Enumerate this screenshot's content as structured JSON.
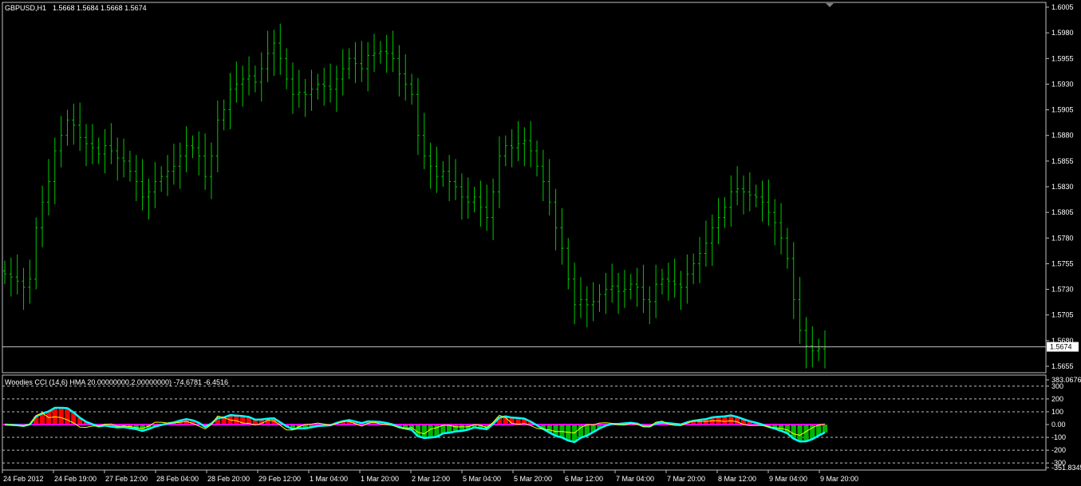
{
  "main_panel": {
    "symbol": "GBPUSD,H1",
    "ohlc": "1.5668 1.5684 1.5668 1.5674",
    "current_price": "1.5674",
    "price_scale": [
      "1.6005",
      "1.5980",
      "1.5955",
      "1.5930",
      "1.5905",
      "1.5880",
      "1.5855",
      "1.5830",
      "1.5805",
      "1.5780",
      "1.5755",
      "1.5730",
      "1.5705",
      "1.5680",
      "1.5655"
    ]
  },
  "indicator_panel": {
    "title": "Woodies CCI (14,6) HMA 20.00000000,2.00000000) -74.6781 -6.4516",
    "scale_labels": [
      "383.0676",
      "300",
      "200",
      "100",
      "0.00",
      "-100",
      "-200",
      "-300",
      "-351.8345"
    ]
  },
  "time_axis": [
    "24 Feb 2012",
    "24 Feb 19:00",
    "27 Feb 12:00",
    "28 Feb 04:00",
    "28 Feb 20:00",
    "29 Feb 12:00",
    "1 Mar 04:00",
    "1 Mar 20:00",
    "2 Mar 12:00",
    "5 Mar 04:00",
    "5 Mar 20:00",
    "6 Mar 12:00",
    "7 Mar 04:00",
    "7 Mar 20:00",
    "8 Mar 12:00",
    "9 Mar 04:00",
    "9 Mar 20:00"
  ],
  "colors": {
    "background": "#000000",
    "grid": "#c0c0c0",
    "bars": "#00c800",
    "text": "#ffffff",
    "cci_positive": "#ff0000",
    "cci_negative": "#00b400",
    "cci_line": "#00ffff",
    "turbo_line": "#ffff00",
    "zero_line": "#ff00ff",
    "zero_fill": "#ff8c00"
  },
  "chart_data": {
    "type": "ohlc",
    "timeframe": "H1",
    "ylim": [
      1.565,
      1.6005
    ],
    "close": [
      1.5745,
      1.5742,
      1.5738,
      1.5732,
      1.574,
      1.579,
      1.5815,
      1.5835,
      1.5865,
      1.588,
      1.5895,
      1.589,
      1.5878,
      1.5872,
      1.5868,
      1.5862,
      1.587,
      1.5865,
      1.5858,
      1.5855,
      1.5845,
      1.5835,
      1.582,
      1.5825,
      1.5835,
      1.584,
      1.5845,
      1.585,
      1.586,
      1.587,
      1.5868,
      1.586,
      1.584,
      1.586,
      1.5895,
      1.5905,
      1.5925,
      1.593,
      1.5935,
      1.5938,
      1.5932,
      1.5945,
      1.596,
      1.597,
      1.5955,
      1.5935,
      1.592,
      1.5922,
      1.592,
      1.5925,
      1.593,
      1.5928,
      1.5925,
      1.5935,
      1.5945,
      1.5955,
      1.595,
      1.5945,
      1.5958,
      1.596,
      1.5962,
      1.596,
      1.5955,
      1.594,
      1.593,
      1.592,
      1.588,
      1.586,
      1.585,
      1.584,
      1.5845,
      1.5835,
      1.583,
      1.582,
      1.5815,
      1.582,
      1.581,
      1.58,
      1.5825,
      1.586,
      1.587,
      1.5868,
      1.5872,
      1.5875,
      1.5865,
      1.585,
      1.5835,
      1.5815,
      1.579,
      1.577,
      1.574,
      1.5715,
      1.572,
      1.5715,
      1.5718,
      1.5725,
      1.573,
      1.5733,
      1.5728,
      1.573,
      1.5735,
      1.5732,
      1.572,
      1.5718,
      1.5735,
      1.574,
      1.5738,
      1.5735,
      1.5732,
      1.5745,
      1.5755,
      1.5765,
      1.5775,
      1.579,
      1.58,
      1.581,
      1.5825,
      1.5828,
      1.5825,
      1.5822,
      1.582,
      1.5815,
      1.5805,
      1.5795,
      1.578,
      1.576,
      1.572,
      1.569,
      1.5675,
      1.567,
      1.5672,
      1.5674
    ]
  }
}
